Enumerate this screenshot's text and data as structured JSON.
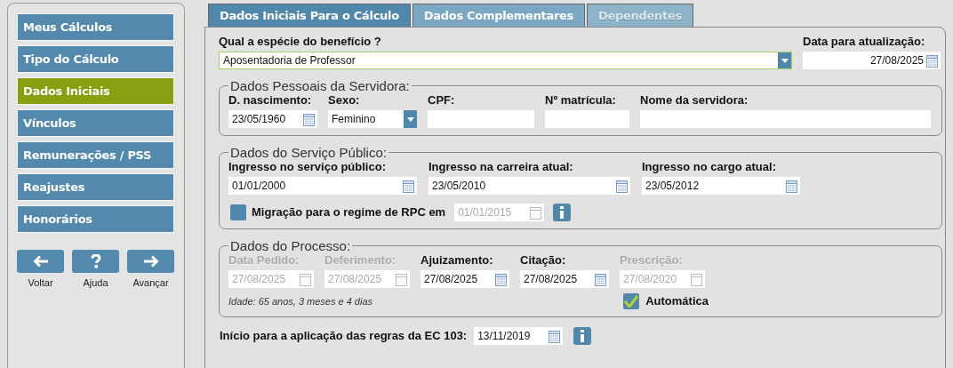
{
  "sidebar": {
    "items": [
      {
        "label": "Meus Cálculos",
        "selected": false
      },
      {
        "label": "Tipo do Cálculo",
        "selected": false
      },
      {
        "label": "Dados Iniciais",
        "selected": true
      },
      {
        "label": "Vínculos",
        "selected": false
      },
      {
        "label": "Remunerações / PSS",
        "selected": false
      },
      {
        "label": "Reajustes",
        "selected": false
      },
      {
        "label": "Honorários",
        "selected": false
      }
    ]
  },
  "nav_buttons": [
    {
      "kind": "back",
      "label": "Voltar"
    },
    {
      "kind": "help",
      "label": "Ajuda"
    },
    {
      "kind": "forward",
      "label": "Avançar"
    }
  ],
  "tabs": [
    {
      "label": "Dados Iniciais Para o Cálculo",
      "selected": true,
      "disabled": false
    },
    {
      "label": "Dados Complementares",
      "selected": false,
      "disabled": false
    },
    {
      "label": "Dependentes",
      "selected": false,
      "disabled": true
    }
  ],
  "benefit": {
    "label": "Qual a espécie do benefício ?",
    "value": "Aposentadoria de Professor"
  },
  "update_date": {
    "label": "Data para atualização:",
    "value": "27/08/2025"
  },
  "sections": [
    {
      "title": "Dados Pessoais da Servidora:",
      "fields": [
        {
          "label": "D. nascimento:",
          "value": "23/05/1960",
          "kind": "date",
          "disabled": false
        },
        {
          "label": "Sexo:",
          "value": "Feminino",
          "kind": "select",
          "disabled": false
        },
        {
          "label": "CPF:",
          "kind": "text"
        },
        {
          "label": "Nº matrícula:",
          "kind": "text"
        },
        {
          "label": "Nome da servidora:",
          "kind": "text"
        }
      ]
    },
    {
      "title": "Dados do Serviço Público:",
      "fields": [
        {
          "label": "Ingresso no serviço público:",
          "value": "01/01/2000",
          "kind": "date",
          "disabled": false
        },
        {
          "label": "Ingresso na carreira atual:",
          "value": "23/05/2010",
          "kind": "date",
          "disabled": false
        },
        {
          "label": "Ingresso no cargo atual:",
          "value": "23/05/2012",
          "kind": "date",
          "disabled": false
        }
      ],
      "migration": {
        "label": "Migração para o regime de RPC em",
        "checked": false,
        "date": "01/01/2015",
        "date_disabled": true
      }
    },
    {
      "title": "Dados do Processo:",
      "fields": [
        {
          "label": "Data Pedido:",
          "value": "27/08/2025",
          "kind": "date",
          "disabled": true
        },
        {
          "label": "Deferimento:",
          "value": "27/08/2025",
          "kind": "date",
          "disabled": true
        },
        {
          "label": "Ajuizamento:",
          "value": "27/08/2025",
          "kind": "date",
          "disabled": false
        },
        {
          "label": "Citação:",
          "value": "27/08/2025",
          "kind": "date",
          "disabled": false
        },
        {
          "label": "Prescrição:",
          "value": "27/08/2020",
          "kind": "date",
          "disabled": true
        }
      ],
      "age_note": "Idade: 65 anos, 3 meses e 4 dias",
      "automatic": {
        "label": "Automática",
        "checked": true
      }
    }
  ],
  "ec103": {
    "label": "Início para a aplicação das regras da EC 103:",
    "value": "13/11/2019"
  }
}
